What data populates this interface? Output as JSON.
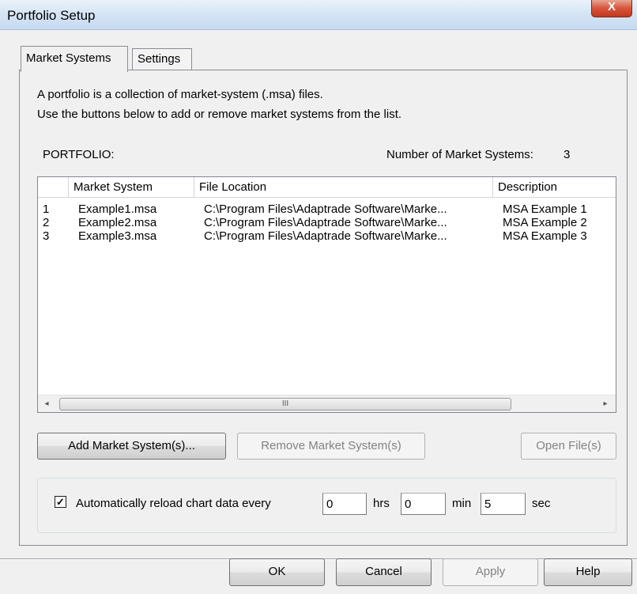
{
  "window": {
    "title": "Portfolio Setup",
    "close_glyph": "X"
  },
  "tabs": [
    {
      "label": "Market Systems",
      "active": true
    },
    {
      "label": "Settings",
      "active": false
    }
  ],
  "intro": {
    "line1": "A portfolio is a collection of market-system (.msa) files.",
    "line2": "Use the buttons below to add or remove market systems from the list."
  },
  "portfolio": {
    "heading": "PORTFOLIO:",
    "count_label": "Number of Market Systems:",
    "count_value": "3"
  },
  "list": {
    "columns": [
      "",
      "Market System",
      "File Location",
      "Description"
    ],
    "rows": [
      {
        "index": "1",
        "system": "Example1.msa",
        "location": "C:\\Program Files\\Adaptrade Software\\Marke...",
        "description": "MSA Example 1"
      },
      {
        "index": "2",
        "system": "Example2.msa",
        "location": "C:\\Program Files\\Adaptrade Software\\Marke...",
        "description": "MSA Example 2"
      },
      {
        "index": "3",
        "system": "Example3.msa",
        "location": "C:\\Program Files\\Adaptrade Software\\Marke...",
        "description": "MSA Example 3"
      }
    ],
    "scrollbar": {
      "left_arrow": "◂",
      "right_arrow": "▸",
      "grip": "III"
    }
  },
  "actions": {
    "add": "Add Market System(s)...",
    "remove": "Remove Market System(s)",
    "open": "Open File(s)"
  },
  "reload": {
    "checked": true,
    "check_glyph": "✓",
    "label": "Automatically reload chart data every",
    "hrs_value": "0",
    "hrs_label": "hrs",
    "min_value": "0",
    "min_label": "min",
    "sec_value": "5",
    "sec_label": "sec"
  },
  "footer": {
    "ok": "OK",
    "cancel": "Cancel",
    "apply": "Apply",
    "help": "Help"
  }
}
